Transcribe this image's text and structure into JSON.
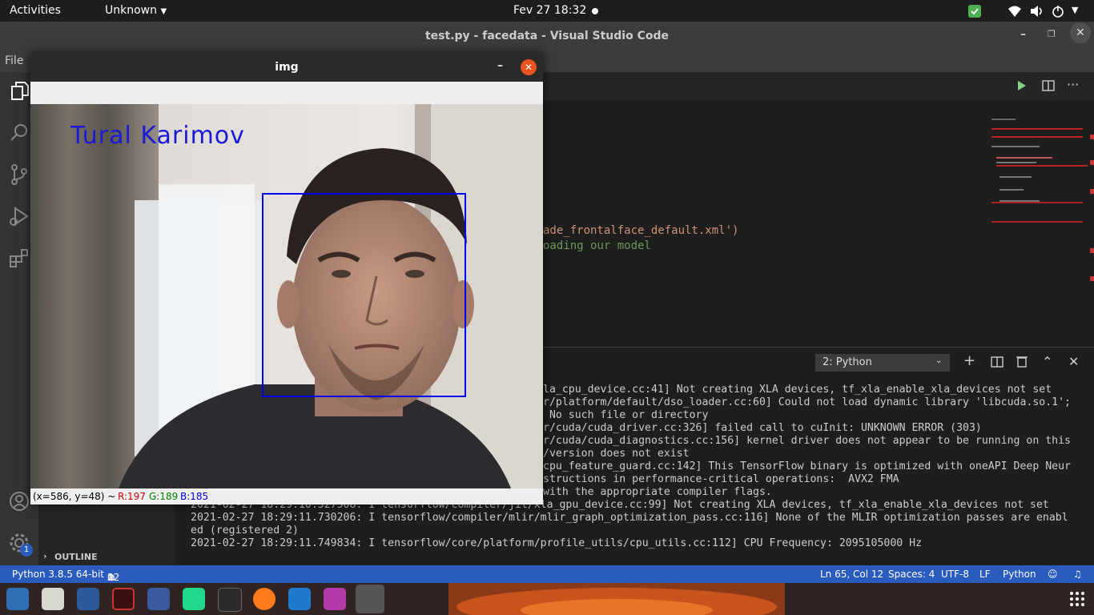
{
  "topbar": {
    "activities": "Activities",
    "app_menu": "Unknown",
    "datetime": "Fev 27  18:32"
  },
  "vscode": {
    "title": "test.py - facedata - Visual Studio Code",
    "menu_file": "File",
    "code_line1": "ade_frontalface_default.xml')",
    "code_line2": "oading our model",
    "outline_label": "OUTLINE",
    "notification_count": "1"
  },
  "terminal": {
    "selector": "2: Python",
    "lines": [
      "la_cpu_device.cc:41] Not creating XLA devices, tf_xla_enable_xla_devices not set",
      "r/platform/default/dso_loader.cc:60] Could not load dynamic library 'libcuda.so.1';",
      " No such file or directory",
      "r/cuda/cuda_driver.cc:326] failed call to cuInit: UNKNOWN ERROR (303)",
      "r/cuda/cuda_diagnostics.cc:156] kernel driver does not appear to be running on this",
      "/version does not exist",
      "cpu_feature_guard.cc:142] This TensorFlow binary is optimized with oneAPI Deep Neur",
      "structions in performance-critical operations:  AVX2 FMA",
      "with the appropriate compiler flags.",
      "2021-02-27 18:29:10.527508: I tensorflow/compiler/jit/xla_gpu_device.cc:99] Not creating XLA devices, tf_xla_enable_xla_devices not set",
      "2021-02-27 18:29:11.730206: I tensorflow/compiler/mlir/mlir_graph_optimization_pass.cc:116] None of the MLIR optimization passes are enabl",
      "ed (registered 2)",
      "2021-02-27 18:29:11.749834: I tensorflow/core/platform/profile_utils/cpu_utils.cc:112] CPU Frequency: 2095105000 Hz"
    ]
  },
  "statusbar": {
    "python": "Python 3.8.5 64-bit",
    "errors": "12",
    "warnings": "0",
    "position": "Ln 65, Col 12",
    "spaces": "Spaces: 4",
    "encoding": "UTF-8",
    "eol": "LF",
    "language": "Python"
  },
  "imgwindow": {
    "title": "img",
    "label": "Tural Karimov",
    "coords": "(x=586, y=48) ~",
    "r": "R:197",
    "g": "G:189",
    "b": "B:185"
  },
  "colors": {
    "statusbar": "#2a5bbf",
    "label_text": "#1a1ad6",
    "face_box": "#0000ee",
    "close_button": "#e95420"
  }
}
